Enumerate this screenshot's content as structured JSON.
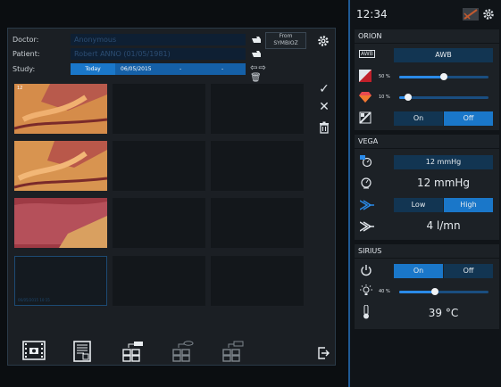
{
  "left": {
    "doctor_label": "Doctor:",
    "doctor_value": "Anonymous",
    "patient_label": "Patient:",
    "patient_value": "Robert ANNO  (01/05/1981)",
    "study_label": "Study:",
    "study_today": "Today",
    "study_date": "06/05/2015",
    "study_dash1": "-",
    "study_dash2": "-",
    "from_button": "From SYMBIOZ",
    "thumb_label_1": "12",
    "selected_timestamp": "06/05/2015 10:15"
  },
  "right": {
    "time": "12:34",
    "orion": {
      "title": "ORION",
      "awb_label": "AWB",
      "awb_button": "AWB",
      "slider1_pct": "50 %",
      "slider1_value": 0.5,
      "slider2_pct": "10 %",
      "slider2_value": 0.1,
      "toggle_on": "On",
      "toggle_off": "Off",
      "toggle_state": "Off"
    },
    "vega": {
      "title": "VEGA",
      "setpoint": "12 mmHg",
      "pressure": "12 mmHg",
      "flow_low": "Low",
      "flow_high": "High",
      "flow_state": "High",
      "flow_rate": "4 l/mn"
    },
    "sirius": {
      "title": "SIRIUS",
      "power_on": "On",
      "power_off": "Off",
      "power_state": "On",
      "light_pct": "40 %",
      "light_value": 0.4,
      "temperature": "39 °C"
    }
  },
  "colors": {
    "accent": "#1a77c9",
    "panel": "#1c2126",
    "border": "#1f5a94"
  }
}
